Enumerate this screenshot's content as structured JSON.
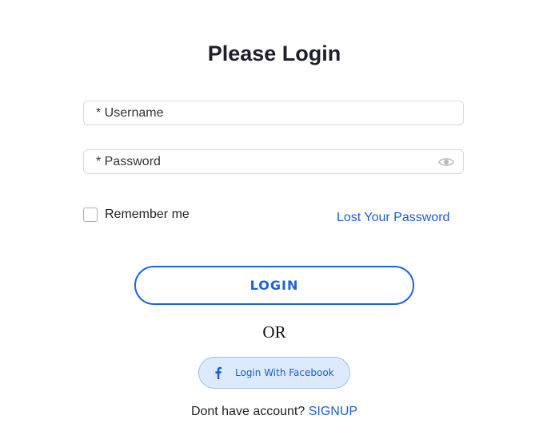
{
  "page": {
    "title": "Please Login"
  },
  "form": {
    "username": {
      "placeholder": "* Username",
      "value": ""
    },
    "password": {
      "placeholder": "* Password",
      "value": "",
      "toggle_icon": "eye-icon"
    },
    "remember_me": {
      "label": "Remember me",
      "checked": false
    },
    "lost_password_link": "Lost Your Password",
    "login_button": "LOGIN"
  },
  "divider": {
    "text": "OR"
  },
  "social": {
    "facebook_button": "Login With Facebook",
    "facebook_icon": "facebook-icon"
  },
  "signup": {
    "prompt": "Dont have account?",
    "link": "SIGNUP"
  },
  "colors": {
    "accent": "#1b62e0",
    "link": "#1a5fd1",
    "facebook_bg": "#dceafc",
    "facebook_border": "#9cc0ee",
    "input_border": "#d6d9de"
  }
}
